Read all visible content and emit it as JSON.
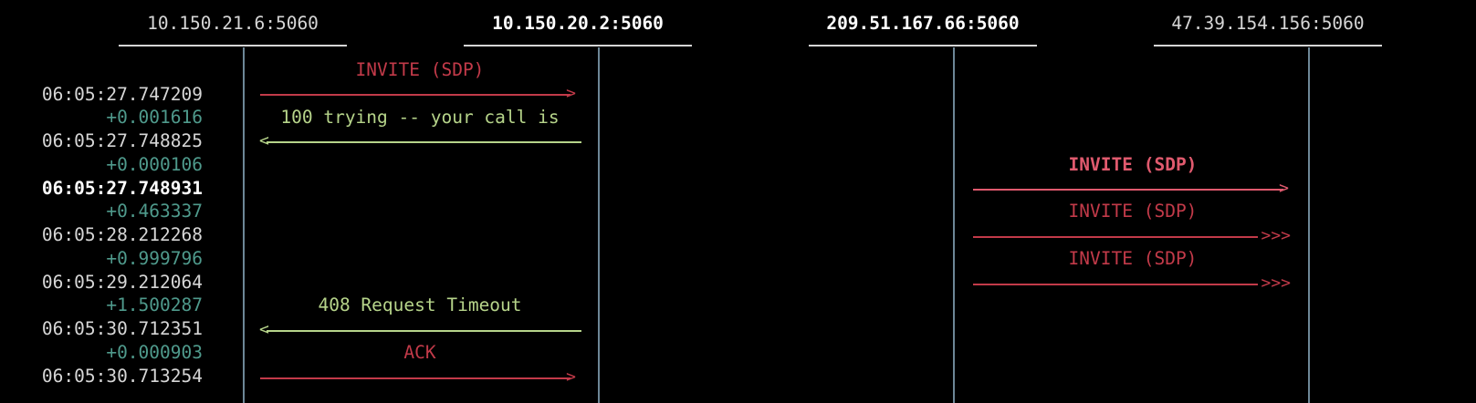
{
  "hosts": [
    "10.150.21.6:5060",
    "10.150.20.2:5060",
    "209.51.167.66:5060",
    "47.39.154.156:5060"
  ],
  "rows": [
    {
      "abs": "06:05:27.747209",
      "delta": "+0.001616"
    },
    {
      "abs": "06:05:27.748825",
      "delta": "+0.000106"
    },
    {
      "abs": "06:05:27.748931",
      "delta": "+0.463337"
    },
    {
      "abs": "06:05:28.212268",
      "delta": "+0.999796"
    },
    {
      "abs": "06:05:29.212064",
      "delta": "+1.500287"
    },
    {
      "abs": "06:05:30.712351",
      "delta": "+0.000903"
    },
    {
      "abs": "06:05:30.713254"
    }
  ],
  "messages": [
    {
      "label": "INVITE (SDP)",
      "arrow_head": ">"
    },
    {
      "label": "100 trying -- your call is",
      "arrow_head": "<"
    },
    {
      "label": "INVITE (SDP)",
      "arrow_head": ">"
    },
    {
      "label": "INVITE (SDP)",
      "arrow_head": ">>>"
    },
    {
      "label": "INVITE (SDP)",
      "arrow_head": ">>>"
    },
    {
      "label": "408 Request Timeout",
      "arrow_head": "<"
    },
    {
      "label": "ACK",
      "arrow_head": ">"
    }
  ],
  "colors": {
    "request": "#c23a49",
    "request_highlight": "#e05a6e",
    "response": "#b6d48a",
    "delta": "#4f9a8c",
    "lifeline": "#6d8797"
  }
}
